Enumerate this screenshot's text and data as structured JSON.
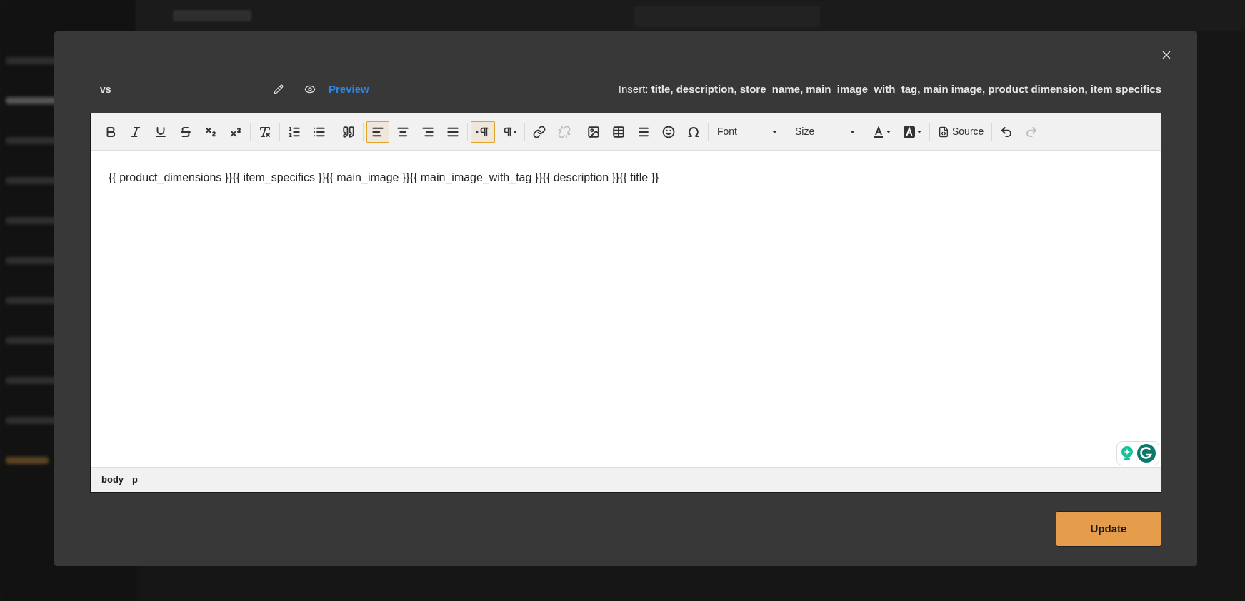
{
  "dialog": {
    "name": "vs",
    "preview_link": "Preview",
    "insert_hint": "Insert: **title, description, store_name, main_image_with_tag, main image, product dimension, item specifics**"
  },
  "toolbar": [
    [
      {
        "kind": "bold",
        "selected": false,
        "disabled": false
      },
      {
        "kind": "italic",
        "selected": false,
        "disabled": false
      },
      {
        "kind": "underline",
        "selected": false,
        "disabled": false
      },
      {
        "kind": "strike",
        "selected": false,
        "disabled": false
      },
      {
        "kind": "subscript",
        "selected": false,
        "disabled": false
      },
      {
        "kind": "superscript",
        "selected": false,
        "disabled": false
      }
    ],
    [
      {
        "kind": "clearformat",
        "selected": false,
        "disabled": false
      }
    ],
    [
      {
        "kind": "numbered",
        "selected": false,
        "disabled": false
      },
      {
        "kind": "bulleted",
        "selected": false,
        "disabled": false
      }
    ],
    [
      {
        "kind": "quote",
        "selected": false,
        "disabled": false
      }
    ],
    [
      {
        "kind": "alignleft",
        "selected": true,
        "disabled": false
      },
      {
        "kind": "aligncenter",
        "selected": false,
        "disabled": false
      },
      {
        "kind": "alignright",
        "selected": false,
        "disabled": false
      },
      {
        "kind": "justify",
        "selected": false,
        "disabled": false
      }
    ],
    [
      {
        "kind": "ltr",
        "selected": true,
        "disabled": false
      },
      {
        "kind": "rtl",
        "selected": false,
        "disabled": false
      }
    ],
    [
      {
        "kind": "link",
        "selected": false,
        "disabled": false
      },
      {
        "kind": "unlink",
        "selected": false,
        "disabled": true
      }
    ],
    [
      {
        "kind": "image",
        "selected": false,
        "disabled": false
      },
      {
        "kind": "table",
        "selected": false,
        "disabled": false
      },
      {
        "kind": "hrule",
        "selected": false,
        "disabled": false
      },
      {
        "kind": "smiley",
        "selected": false,
        "disabled": false
      },
      {
        "kind": "omega",
        "selected": false,
        "disabled": false
      }
    ],
    [
      {
        "kind": "dropdown",
        "label": "Font"
      }
    ],
    [
      {
        "kind": "dropdown",
        "label": "Size"
      }
    ],
    [
      {
        "kind": "textcolor",
        "selected": false,
        "disabled": false
      },
      {
        "kind": "bgcolor",
        "selected": false,
        "disabled": false
      }
    ],
    [
      {
        "kind": "source",
        "label": "Source",
        "selected": false,
        "disabled": false
      }
    ],
    [
      {
        "kind": "undo",
        "selected": false,
        "disabled": false
      },
      {
        "kind": "redo",
        "selected": false,
        "disabled": true
      }
    ]
  ],
  "content": "{{ product_dimensions }}{{ item_specifics }}{{ main_image }}{{ main_image_with_tag }}{{ description }}{{ title }}",
  "path": [
    "body",
    "p"
  ],
  "update_button": "Update"
}
